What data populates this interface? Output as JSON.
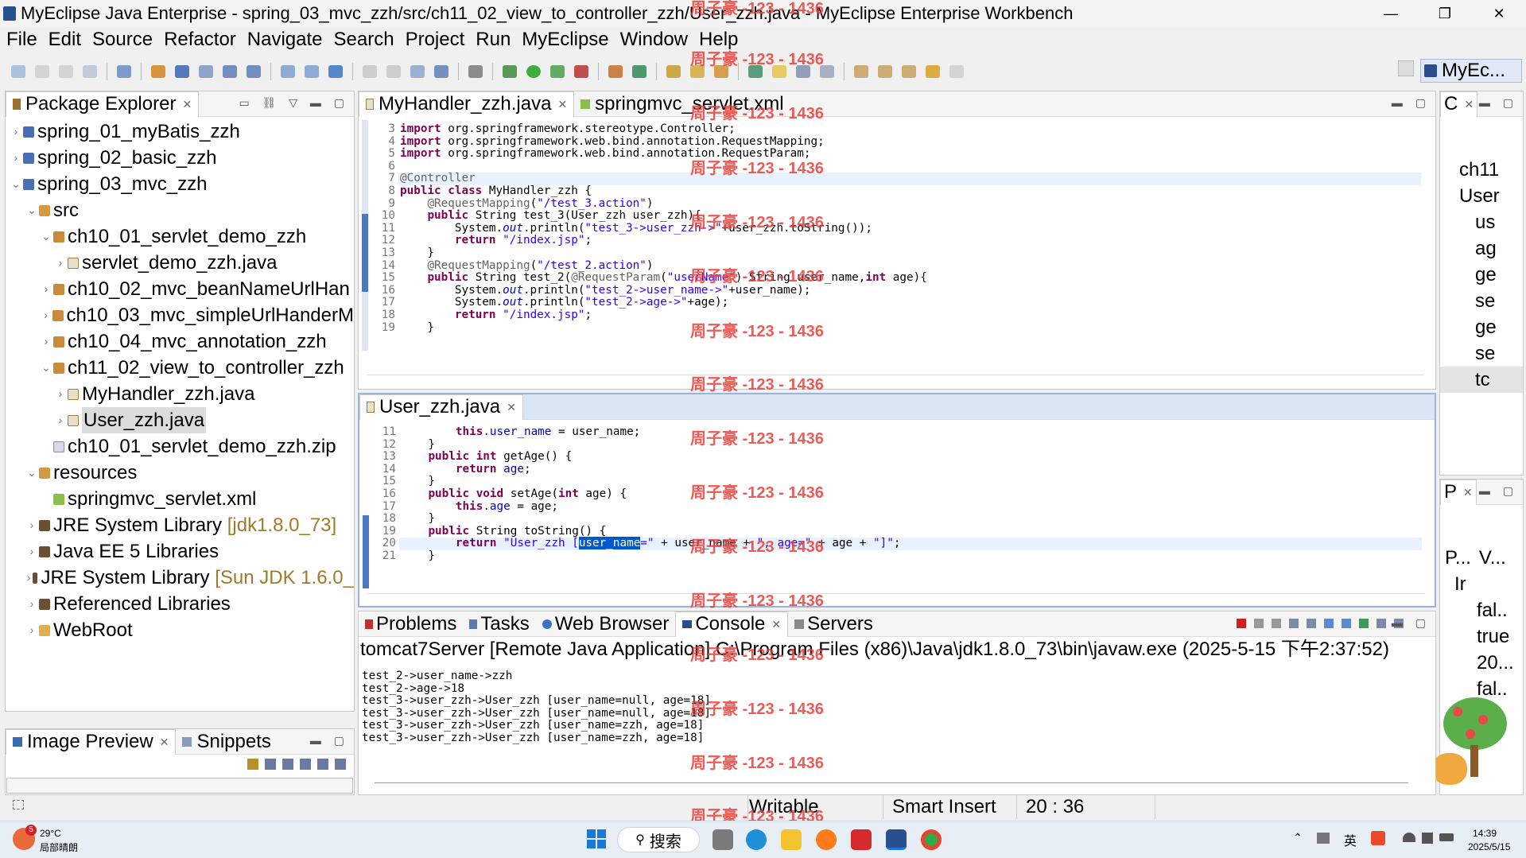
{
  "window": {
    "title": "MyEclipse Java Enterprise - spring_03_mvc_zzh/src/ch11_02_view_to_controller_zzh/User_zzh.java - MyEclipse Enterprise Workbench",
    "minimize": "—",
    "restore": "❐",
    "close": "✕"
  },
  "menu": [
    "File",
    "Edit",
    "Source",
    "Refactor",
    "Navigate",
    "Search",
    "Project",
    "Run",
    "MyEclipse",
    "Window",
    "Help"
  ],
  "perspective": "MyEc...",
  "package_explorer": {
    "title": "Package Explorer",
    "items": [
      {
        "label": "spring_01_myBatis_zzh",
        "decor": ""
      },
      {
        "label": "spring_02_basic_zzh",
        "decor": ""
      },
      {
        "label": "spring_03_mvc_zzh",
        "decor": ""
      },
      {
        "label": "src",
        "decor": ""
      },
      {
        "label": "ch10_01_servlet_demo_zzh",
        "decor": ""
      },
      {
        "label": "servlet_demo_zzh.java",
        "decor": ""
      },
      {
        "label": "ch10_02_mvc_beanNameUrlHan",
        "decor": ""
      },
      {
        "label": "ch10_03_mvc_simpleUrlHanderM",
        "decor": ""
      },
      {
        "label": "ch10_04_mvc_annotation_zzh",
        "decor": ""
      },
      {
        "label": "ch11_02_view_to_controller_zzh",
        "decor": ""
      },
      {
        "label": "MyHandler_zzh.java",
        "decor": ""
      },
      {
        "label": "User_zzh.java",
        "decor": ""
      },
      {
        "label": "ch10_01_servlet_demo_zzh.zip",
        "decor": ""
      },
      {
        "label": "resources",
        "decor": ""
      },
      {
        "label": "springmvc_servlet.xml",
        "decor": ""
      },
      {
        "label": "JRE System Library",
        "decor": "[jdk1.8.0_73]"
      },
      {
        "label": "Java EE 5 Libraries",
        "decor": ""
      },
      {
        "label": "JRE System Library",
        "decor": "[Sun JDK 1.6.0_"
      },
      {
        "label": "Referenced Libraries",
        "decor": ""
      },
      {
        "label": "WebRoot",
        "decor": ""
      }
    ]
  },
  "image_preview": {
    "tab1": "Image Preview",
    "tab2": "Snippets"
  },
  "editor_top": {
    "tab1": "MyHandler_zzh.java",
    "tab2": "springmvc_servlet.xml",
    "line_numbers": [
      "3",
      "4",
      "5",
      "6",
      "7",
      "8",
      "9",
      "10",
      "11",
      "12",
      "13",
      "14",
      "15",
      "16",
      "17",
      "18",
      "19"
    ]
  },
  "editor_bottom": {
    "tab": "User_zzh.java",
    "line_numbers": [
      "11",
      "12",
      "13",
      "14",
      "15",
      "16",
      "17",
      "18",
      "19",
      "20",
      "21"
    ]
  },
  "outline": {
    "tab": "C",
    "items": [
      "ch11",
      "User",
      "us",
      "ag",
      "ge",
      "se",
      "ge",
      "se",
      "tc"
    ]
  },
  "properties": {
    "tab": "P",
    "headers": [
      "P...",
      "V..."
    ],
    "subheader": "Ir",
    "values": [
      "fal..",
      "true",
      "20...",
      "fal.."
    ]
  },
  "console_views": {
    "tabs": [
      "Problems",
      "Tasks",
      "Web Browser",
      "Console",
      "Servers"
    ],
    "launch": "tomcat7Server [Remote Java Application] C:\\Program Files (x86)\\Java\\jdk1.8.0_73\\bin\\javaw.exe (2025-5-15 下午2:37:52)",
    "lines": [
      "test_2->user_name->zzh",
      "test_2->age->18",
      "test_3->user_zzh->User_zzh [user_name=null, age=18]",
      "test_3->user_zzh->User_zzh [user_name=null, age=18]",
      "test_3->user_zzh->User_zzh [user_name=zzh, age=18]",
      "test_3->user_zzh->User_zzh [user_name=zzh, age=18]"
    ]
  },
  "status": {
    "writable": "Writable",
    "insert": "Smart Insert",
    "position": "20 : 36"
  },
  "watermark": "周子豪 -123 - 1436",
  "taskbar": {
    "weather_temp": "29°C",
    "weather_desc": "局部晴朗",
    "weather_badge": "5",
    "search": "搜索",
    "ime": "英",
    "time": "14:39",
    "date": "2025/5/15"
  },
  "colors": {
    "keyword": "#7f0055",
    "string": "#2a00ff",
    "field": "#0000c0",
    "selection": "#0058d0",
    "watermark": "#e8403a"
  }
}
